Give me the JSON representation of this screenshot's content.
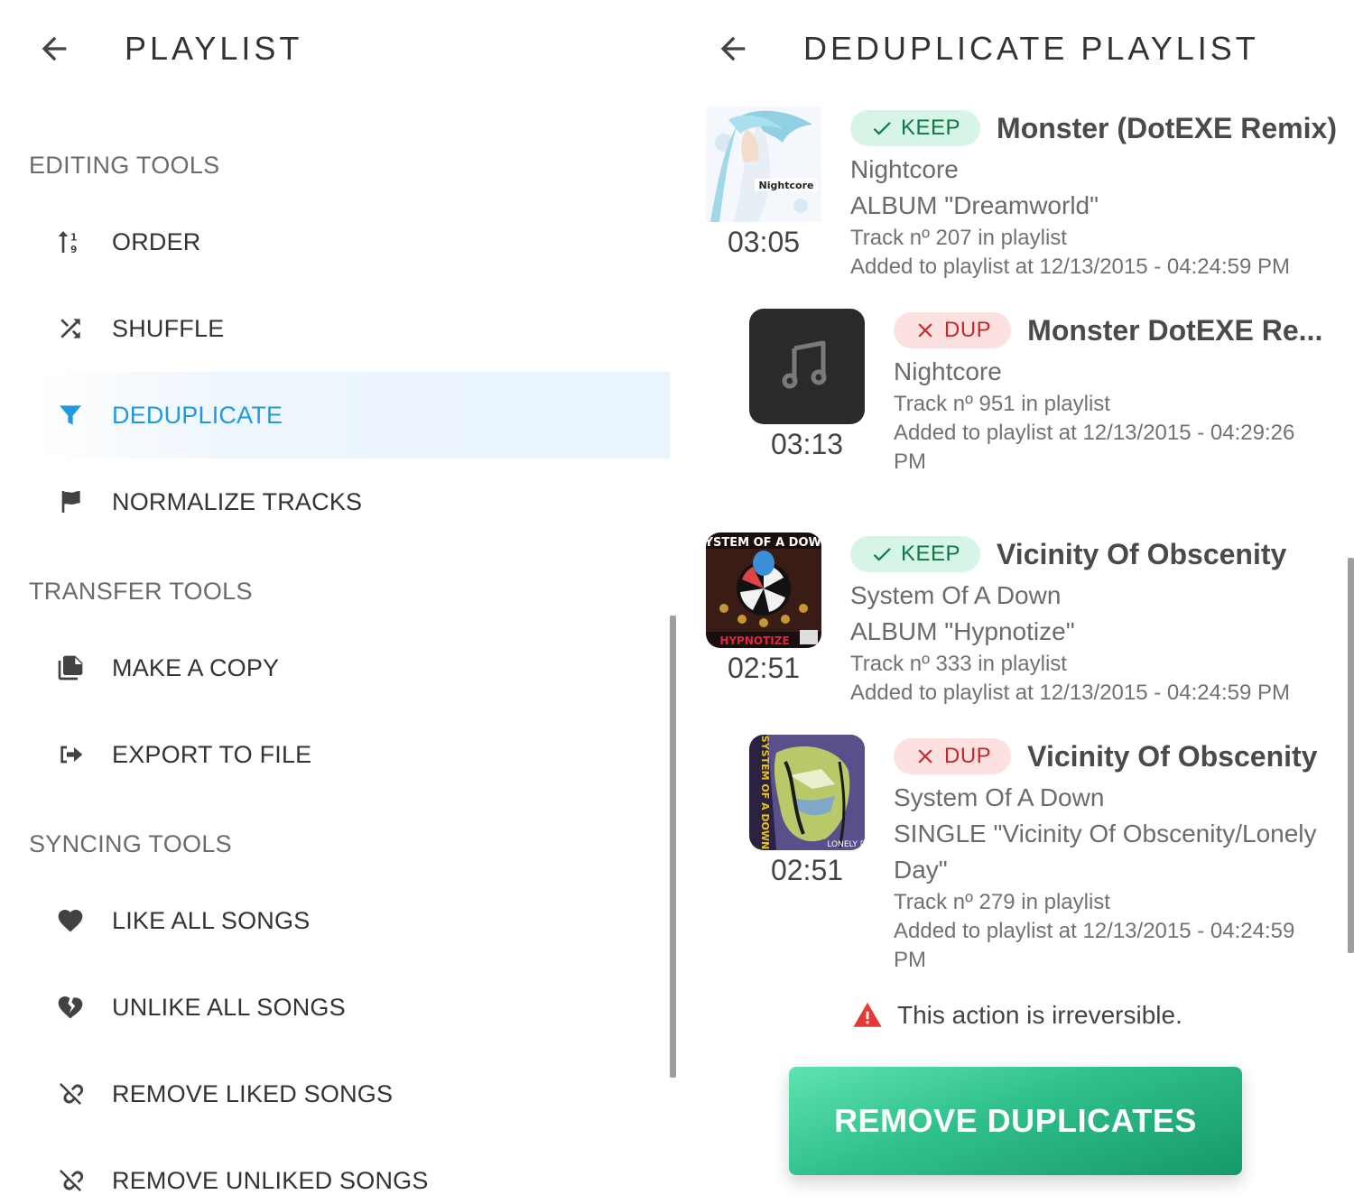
{
  "left": {
    "title": "PLAYLIST",
    "sections": [
      {
        "title": "EDITING TOOLS",
        "items": [
          "ORDER",
          "SHUFFLE",
          "DEDUPLICATE",
          "NORMALIZE TRACKS"
        ]
      },
      {
        "title": "TRANSFER TOOLS",
        "items": [
          "MAKE A COPY",
          "EXPORT TO FILE"
        ]
      },
      {
        "title": "SYNCING TOOLS",
        "items": [
          "LIKE ALL SONGS",
          "UNLIKE ALL SONGS",
          "REMOVE LIKED SONGS",
          "REMOVE UNLIKED SONGS"
        ]
      }
    ],
    "active_item": "DEDUPLICATE"
  },
  "right": {
    "title": "DEDUPLICATE PLAYLIST",
    "tracks": [
      {
        "status": "KEEP",
        "title": "Monster (DotEXE Remix)",
        "artist": "Nightcore",
        "album": "ALBUM \"Dreamworld\"",
        "track_no": "Track nº 207 in playlist",
        "added": "Added to playlist at 12/13/2015 - 04:24:59 PM",
        "duration": "03:05",
        "cover_text": "Nightcore"
      },
      {
        "status": "DUP",
        "title": "Monster DotEXE Re...",
        "artist": "Nightcore",
        "track_no": "Track nº 951 in playlist",
        "added_line1": "Added to playlist at 12/13/2015 - 04:29:26",
        "added_line2": "PM",
        "duration": "03:13"
      },
      {
        "status": "KEEP",
        "title": "Vicinity Of Obscenity",
        "artist": "System Of A Down",
        "album": "ALBUM \"Hypnotize\"",
        "track_no": "Track nº 333 in playlist",
        "added": "Added to playlist at 12/13/2015 - 04:24:59 PM",
        "duration": "02:51",
        "cover_text_top": "SYSTEM OF A DOWN",
        "cover_text_bottom": "HYPNOTIZE"
      },
      {
        "status": "DUP",
        "title": "Vicinity Of Obscenity",
        "artist": "System Of A Down",
        "album_line1": "SINGLE \"Vicinity Of Obscenity/Lonely",
        "album_line2": "Day\"",
        "track_no": "Track nº 279 in playlist",
        "added_line1": "Added to playlist at 12/13/2015 - 04:24:59",
        "added_line2": "PM",
        "duration": "02:51",
        "cover_text_side": "SYSTEM OF A DOWN",
        "cover_text_bottom": "LONELY D"
      }
    ],
    "warning": "This action is irreversible.",
    "action_button": "REMOVE DUPLICATES"
  },
  "colors": {
    "accent": "#1e9be0",
    "keep_bg": "#d7f5e6",
    "keep_fg": "#0b7a45",
    "dup_bg": "#fde0e0",
    "dup_fg": "#c62828",
    "cta_start": "#5ee3b0",
    "cta_end": "#16996a",
    "warning": "#e53935"
  },
  "icons": {
    "back": "arrow-left-icon",
    "order": "sort-numeric-icon",
    "shuffle": "shuffle-icon",
    "deduplicate": "filter-icon",
    "normalize": "flag-icon",
    "copy": "copy-icon",
    "export": "export-icon",
    "like": "heart-icon",
    "unlike": "broken-heart-icon",
    "remove_liked": "unlink-icon",
    "remove_unliked": "unlink-icon",
    "keep": "check-icon",
    "dup": "close-icon",
    "warning": "warning-triangle-icon",
    "music": "music-note-icon"
  }
}
